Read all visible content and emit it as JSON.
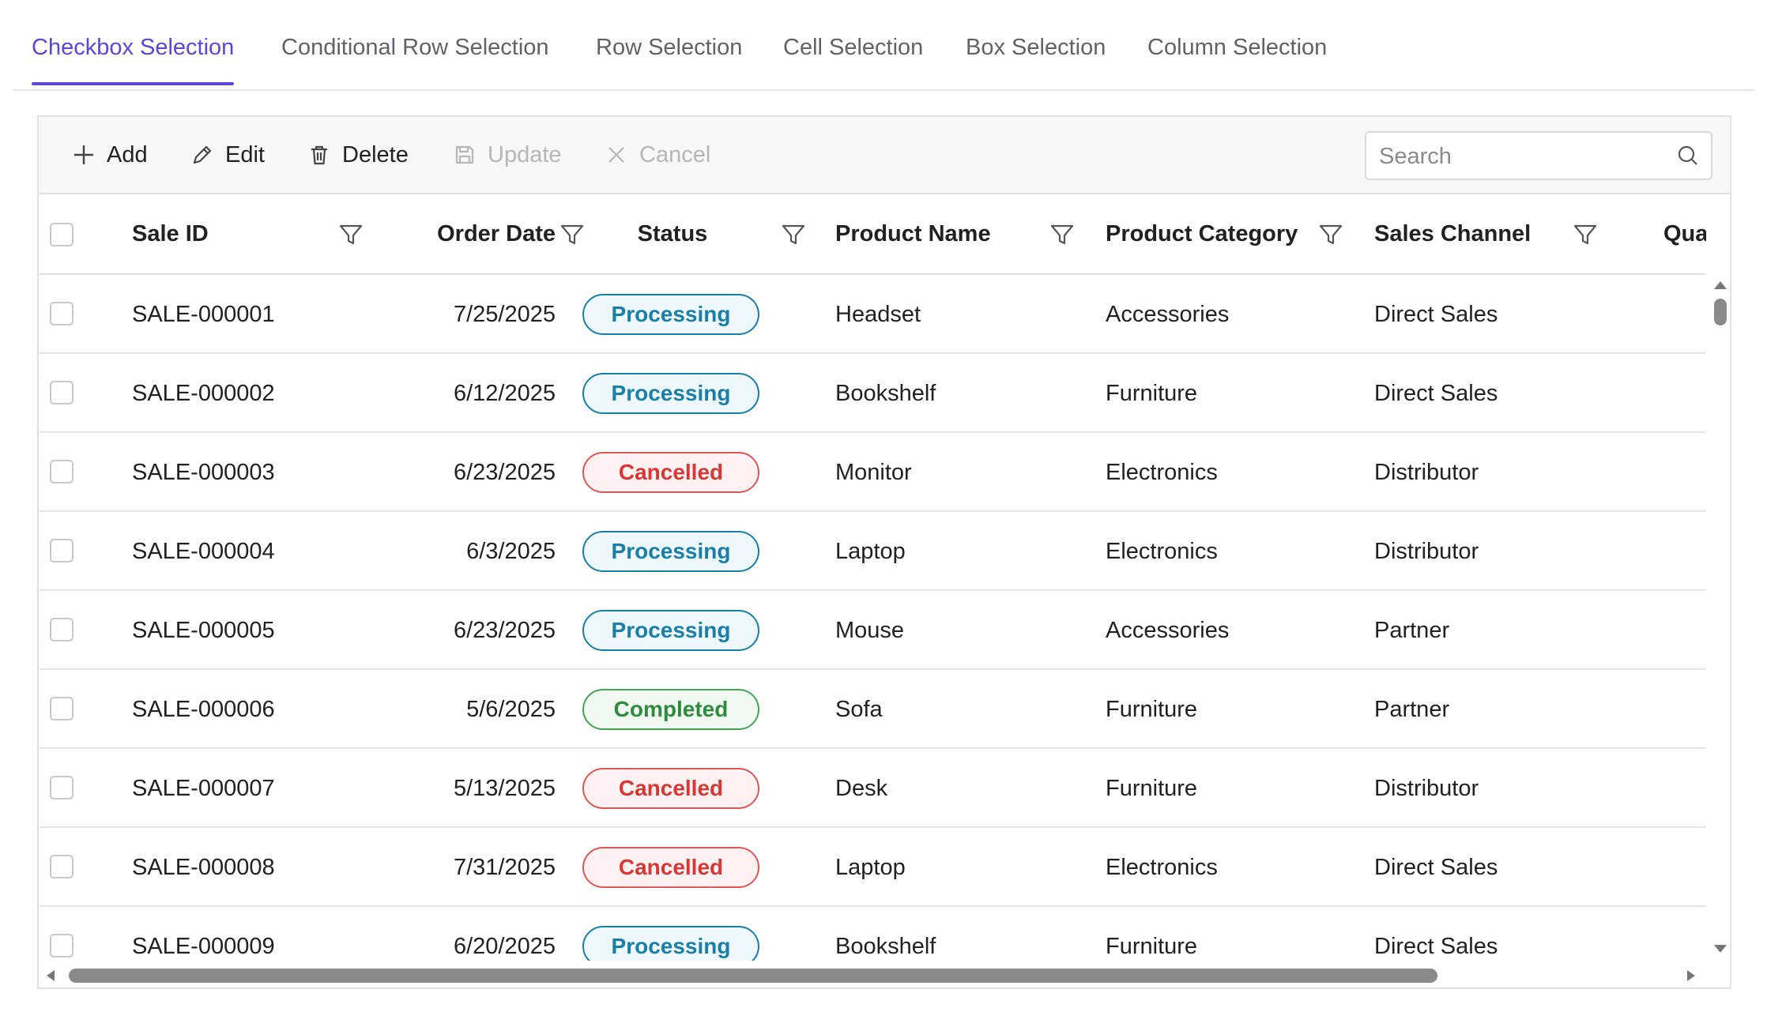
{
  "tabs": [
    {
      "label": "Checkbox Selection",
      "active": true
    },
    {
      "label": "Conditional Row Selection",
      "active": false
    },
    {
      "label": "Row Selection",
      "active": false
    },
    {
      "label": "Cell Selection",
      "active": false
    },
    {
      "label": "Box Selection",
      "active": false
    },
    {
      "label": "Column Selection",
      "active": false
    }
  ],
  "toolbar": {
    "add_label": "Add",
    "edit_label": "Edit",
    "delete_label": "Delete",
    "update_label": "Update",
    "cancel_label": "Cancel",
    "search_placeholder": "Search"
  },
  "columns": {
    "sale_id": "Sale ID",
    "order_date": "Order Date",
    "status": "Status",
    "product_name": "Product Name",
    "product_category": "Product Category",
    "sales_channel": "Sales Channel",
    "quantity": "Quantity"
  },
  "status_colors": {
    "Processing": {
      "text": "#1a7fa8",
      "border": "#1a7fa8",
      "bg": "#eef7fb"
    },
    "Cancelled": {
      "text": "#d93636",
      "border": "#e05757",
      "bg": "#fdf1f1"
    },
    "Completed": {
      "text": "#2e8b3d",
      "border": "#45a355",
      "bg": "#f0faf1"
    }
  },
  "rows": [
    {
      "id": "SALE-000001",
      "date": "7/25/2025",
      "status": "Processing",
      "product": "Headset",
      "category": "Accessories",
      "channel": "Direct Sales"
    },
    {
      "id": "SALE-000002",
      "date": "6/12/2025",
      "status": "Processing",
      "product": "Bookshelf",
      "category": "Furniture",
      "channel": "Direct Sales"
    },
    {
      "id": "SALE-000003",
      "date": "6/23/2025",
      "status": "Cancelled",
      "product": "Monitor",
      "category": "Electronics",
      "channel": "Distributor"
    },
    {
      "id": "SALE-000004",
      "date": "6/3/2025",
      "status": "Processing",
      "product": "Laptop",
      "category": "Electronics",
      "channel": "Distributor"
    },
    {
      "id": "SALE-000005",
      "date": "6/23/2025",
      "status": "Processing",
      "product": "Mouse",
      "category": "Accessories",
      "channel": "Partner"
    },
    {
      "id": "SALE-000006",
      "date": "5/6/2025",
      "status": "Completed",
      "product": "Sofa",
      "category": "Furniture",
      "channel": "Partner"
    },
    {
      "id": "SALE-000007",
      "date": "5/13/2025",
      "status": "Cancelled",
      "product": "Desk",
      "category": "Furniture",
      "channel": "Distributor"
    },
    {
      "id": "SALE-000008",
      "date": "7/31/2025",
      "status": "Cancelled",
      "product": "Laptop",
      "category": "Electronics",
      "channel": "Direct Sales"
    },
    {
      "id": "SALE-000009",
      "date": "6/20/2025",
      "status": "Processing",
      "product": "Bookshelf",
      "category": "Furniture",
      "channel": "Direct Sales"
    }
  ]
}
